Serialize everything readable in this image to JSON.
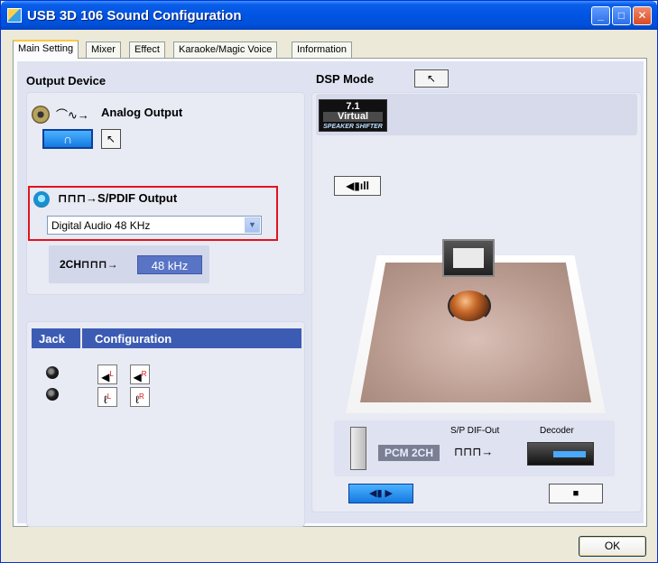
{
  "window": {
    "title": "USB 3D 106 Sound Configuration",
    "controls": {
      "minimize": "_",
      "maximize": "□",
      "close": "✕"
    }
  },
  "tabs": [
    {
      "label": "Main Setting",
      "active": true
    },
    {
      "label": "Mixer",
      "active": false
    },
    {
      "label": "Effect",
      "active": false
    },
    {
      "label": "Karaoke/Magic Voice",
      "active": false
    },
    {
      "label": "Information",
      "active": false
    }
  ],
  "output_device": {
    "title": "Output Device",
    "analog": {
      "label": "Analog Output",
      "wave_glyph": "⌒∿→",
      "headphone_glyph": "∩",
      "tool_glyph": "↖"
    },
    "spdif": {
      "label": "S/PDIF Output",
      "wave_glyph": "⊓⊓⊓→",
      "selected": "Digital Audio 48 KHz",
      "channel_label": "2CH",
      "channel_wave": "⊓⊓⊓→",
      "rate": "48 kHz"
    }
  },
  "jack": {
    "header_jack": "Jack",
    "header_config": "Configuration",
    "rows": [
      {
        "left": {
          "glyph": "◀",
          "sup": "L"
        },
        "right": {
          "glyph": "◀",
          "sup": "R"
        }
      },
      {
        "left": {
          "glyph": "ℓ",
          "sup": "L"
        },
        "right": {
          "glyph": "ℓ",
          "sup": "R"
        }
      }
    ]
  },
  "dsp": {
    "title": "DSP Mode",
    "tool_glyph": "↖",
    "virtual_icon": {
      "line1": "7.1",
      "line2": "Virtual",
      "line3": "SPEAKER SHIFTER"
    },
    "volume_glyph": "◀▮ıll"
  },
  "signal": {
    "pcm": "PCM 2CH",
    "spdif_out": "S/P DIF-Out",
    "decoder": "Decoder",
    "wave": "⊓⊓⊓→"
  },
  "controls": {
    "play_glyph": "◀▮ ▶",
    "stop_glyph": "■",
    "ok": "OK"
  }
}
